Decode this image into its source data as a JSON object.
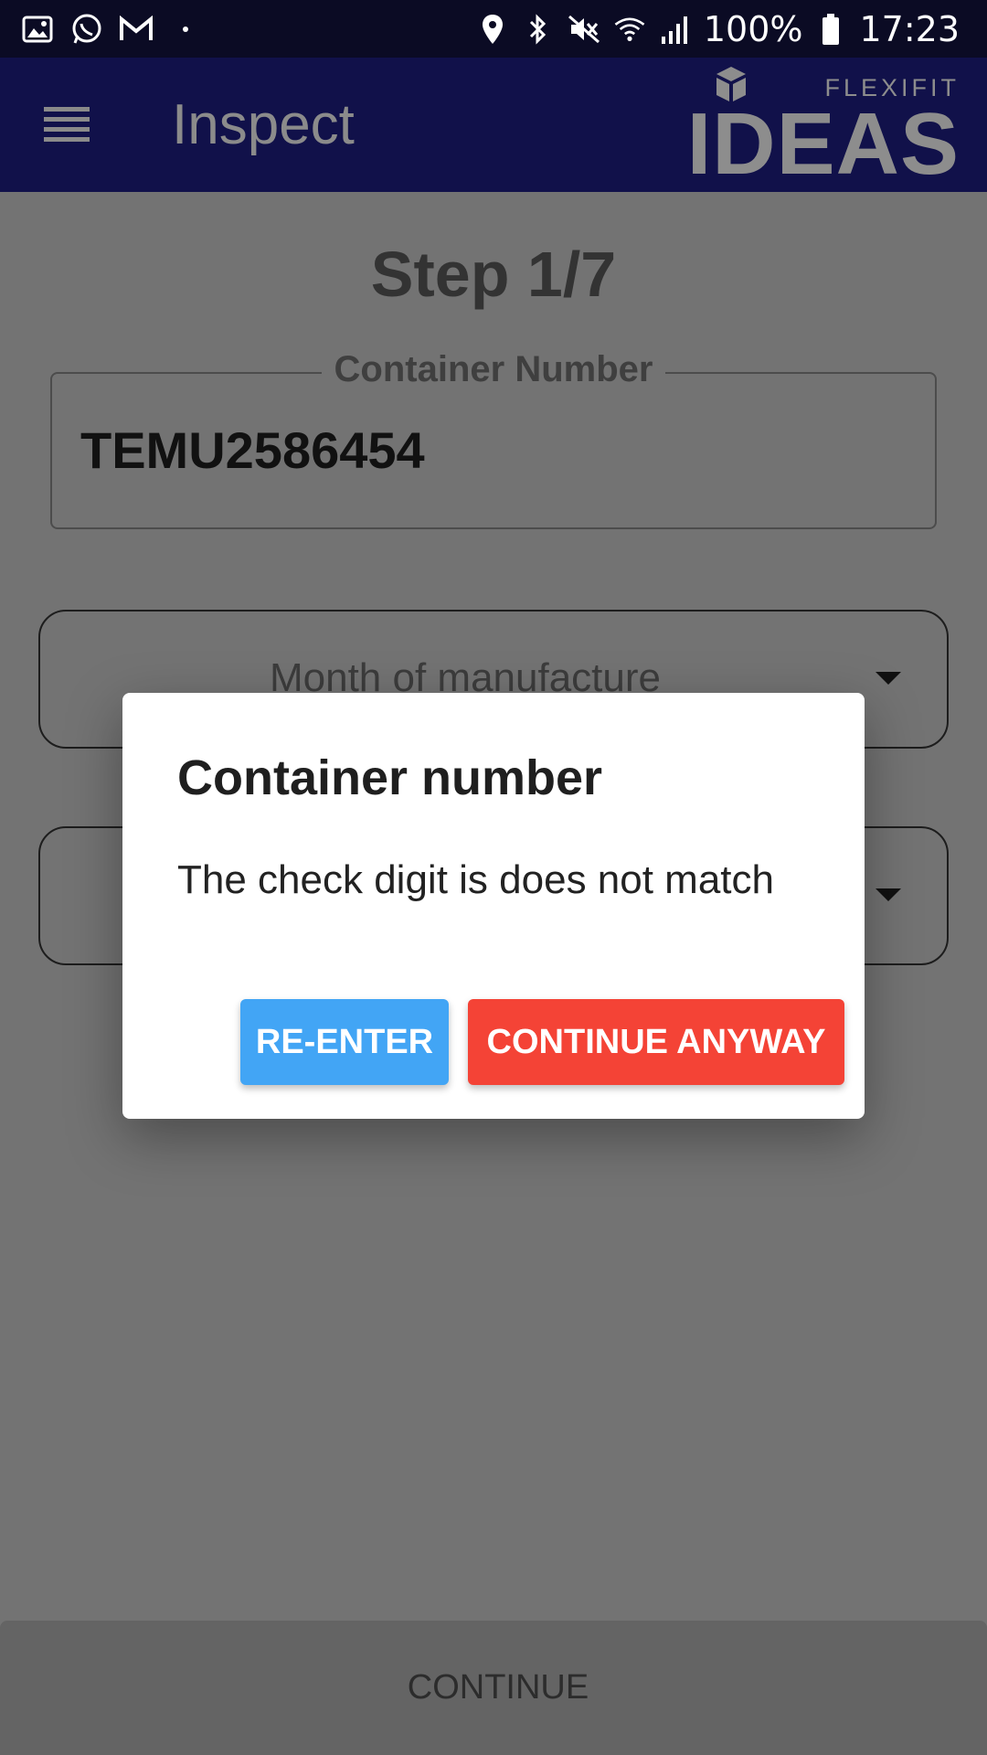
{
  "status_bar": {
    "battery": "100%",
    "time": "17:23",
    "icons": [
      "gallery-icon",
      "whatsapp-icon",
      "gmail-icon",
      "dot-icon",
      "location-icon",
      "bluetooth-icon",
      "mute-icon",
      "wifi-icon",
      "signal-icon",
      "battery-icon"
    ]
  },
  "app_bar": {
    "title": "Inspect",
    "logo_top": "FLEXIFIT",
    "logo_main": "IDEAS"
  },
  "main": {
    "step": "Step 1/7",
    "container_field": {
      "label": "Container Number",
      "value": "TEMU2586454"
    },
    "dropdowns": [
      {
        "placeholder": "Month of manufacture"
      },
      {
        "placeholder": ""
      }
    ],
    "bottom_button": "CONTINUE"
  },
  "dialog": {
    "title": "Container number",
    "message": "The check digit is does not match",
    "reenter_label": "RE-ENTER",
    "continue_label": "CONTINUE ANYWAY",
    "colors": {
      "reenter": "#42a5f5",
      "continue": "#f44336"
    }
  }
}
